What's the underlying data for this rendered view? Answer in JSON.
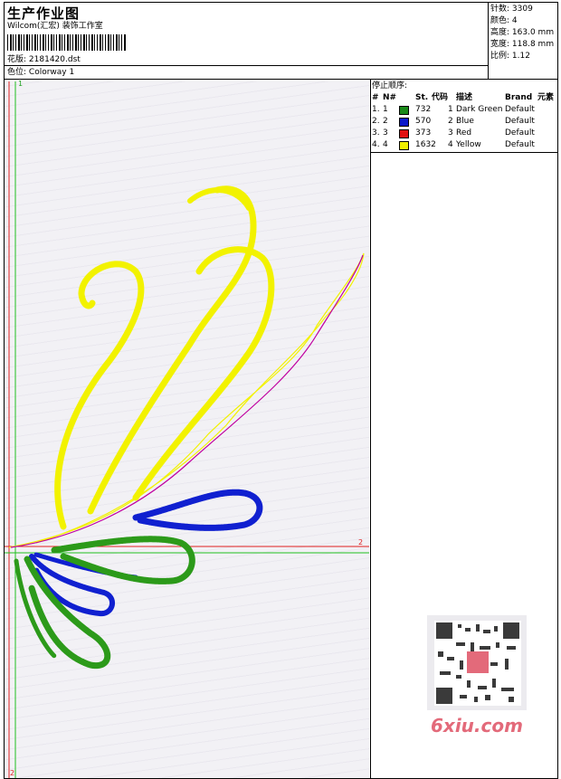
{
  "header": {
    "title": "生产作业图",
    "company": "Wilcom(汇宏) 装饰工作室",
    "design_label": "花版:",
    "design_file": "2181420.dst",
    "colorway_label": "色位:",
    "colorway": "Colorway 1"
  },
  "stats": [
    {
      "label": "针数:",
      "value": "3309"
    },
    {
      "label": "颜色:",
      "value": "4"
    },
    {
      "label": "高度:",
      "value": "163.0 mm"
    },
    {
      "label": "宽度:",
      "value": "118.8 mm"
    },
    {
      "label": "比例:",
      "value": "1.12"
    }
  ],
  "stop_sequence": {
    "title": "停止顺序:",
    "headers": [
      "#",
      "N#",
      "St.",
      "代码",
      "描述",
      "Brand",
      "元素"
    ],
    "rows": [
      {
        "idx": "1.",
        "n": "1",
        "st": "732",
        "code": "1",
        "desc": "Dark Green",
        "brand": "Default",
        "color": "#1a8a1a"
      },
      {
        "idx": "2.",
        "n": "2",
        "st": "570",
        "code": "2",
        "desc": "Blue",
        "brand": "Default",
        "color": "#0a1acc"
      },
      {
        "idx": "3.",
        "n": "3",
        "st": "373",
        "code": "3",
        "desc": "Red",
        "brand": "Default",
        "color": "#e01010"
      },
      {
        "idx": "4.",
        "n": "4",
        "st": "1632",
        "code": "4",
        "desc": "Yellow",
        "brand": "Default",
        "color": "#f0f000"
      }
    ]
  },
  "guides": {
    "axis1": "1",
    "axis2": "2"
  },
  "watermark": {
    "text": "6xiu.com"
  },
  "colors": {
    "yellow": "#f2f200",
    "green": "#2c9a1a",
    "blue": "#1020d0",
    "red_guide": "#e02020",
    "green_guide": "#20c020",
    "magenta_path": "#c000a0"
  }
}
